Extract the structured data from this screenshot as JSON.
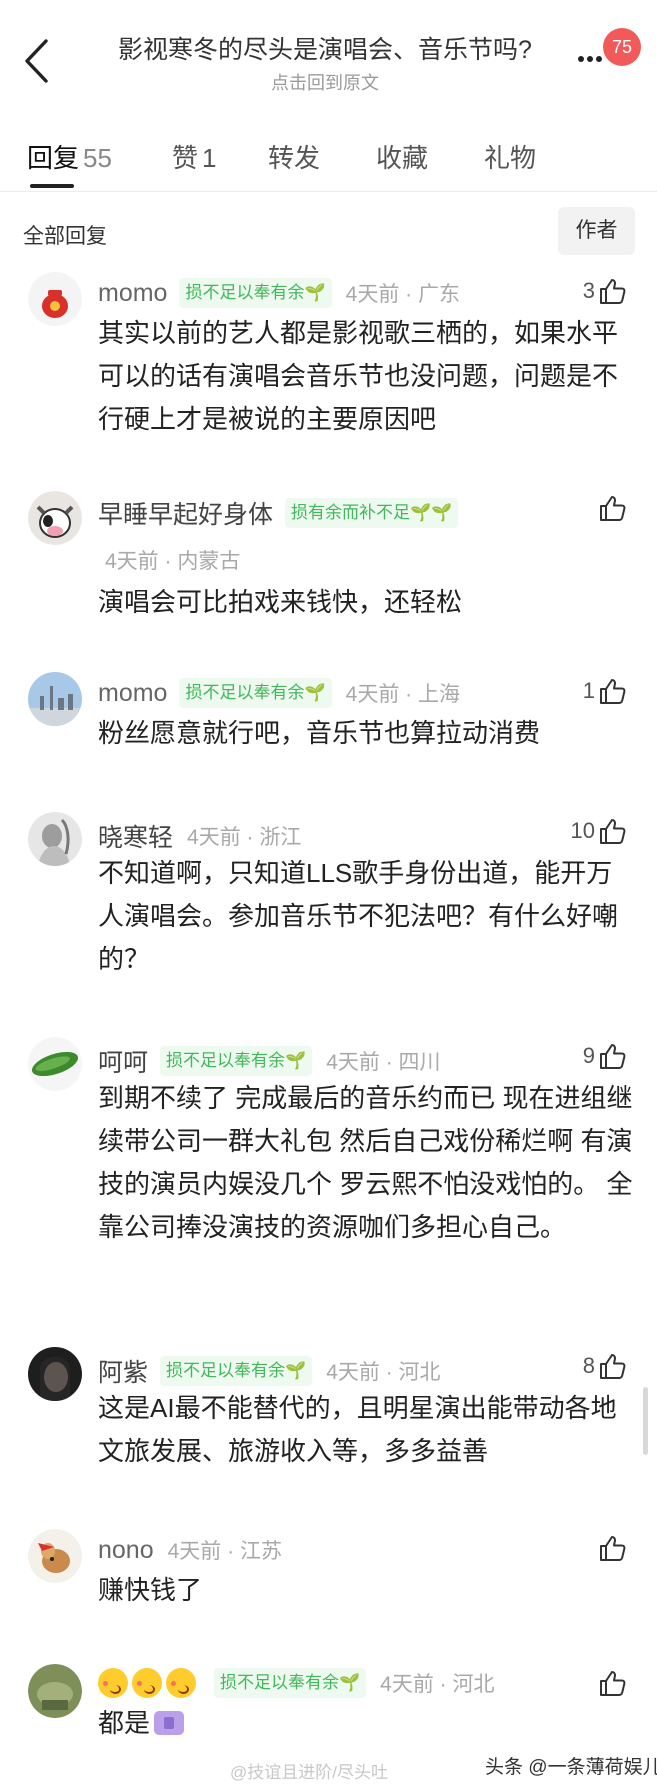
{
  "header": {
    "title": "影视寒冬的尽头是演唱会、音乐节吗?",
    "subtitle": "点击回到原文",
    "badge": "75"
  },
  "tabs": [
    {
      "label": "回复",
      "count": "55"
    },
    {
      "label": "赞",
      "count": "1"
    },
    {
      "label": "转发",
      "count": ""
    },
    {
      "label": "收藏",
      "count": ""
    },
    {
      "label": "礼物",
      "count": ""
    }
  ],
  "filter": {
    "label": "全部回复",
    "author_button": "作者"
  },
  "comments": [
    {
      "name": "momo",
      "tag": "损不足以奉有余🌱",
      "time": "4天前 · 广东",
      "likes": "3",
      "text": "其实以前的艺人都是影视歌三栖的，如果水平可以的话有演唱会音乐节也没问题，问题是不行硬上才是被说的主要原因吧"
    },
    {
      "name": "早睡早起好身体",
      "tag": "损有余而补不足🌱🌱",
      "time": "4天前 · 内蒙古",
      "likes": "",
      "text": "演唱会可比拍戏来钱快，还轻松"
    },
    {
      "name": "momo",
      "tag": "损不足以奉有余🌱",
      "time": "4天前 · 上海",
      "likes": "1",
      "text": "粉丝愿意就行吧，音乐节也算拉动消费"
    },
    {
      "name": "晓寒轻",
      "tag": "",
      "time": "4天前 · 浙江",
      "likes": "10",
      "text": "不知道啊，只知道LLS歌手身份出道，能开万人演唱会。参加音乐节不犯法吧？有什么好嘲的？"
    },
    {
      "name": "呵呵",
      "tag": "损不足以奉有余🌱",
      "time": "4天前 · 四川",
      "likes": "9",
      "text": "到期不续了 完成最后的音乐约而已  现在进组继续带公司一群大礼包 然后自己戏份稀烂啊  有演技的演员内娱没几个  罗云熙不怕没戏怕的。 全靠公司捧没演技的资源咖们多担心自己。"
    },
    {
      "name": "阿紫",
      "tag": "损不足以奉有余🌱",
      "time": "4天前 · 河北",
      "likes": "8",
      "text": "这是AI最不能替代的，且明星演出能带动各地文旅发展、旅游收入等，多多益善"
    },
    {
      "name": "nono",
      "tag": "",
      "time": "4天前 · 江苏",
      "likes": "",
      "text": "赚快钱了"
    },
    {
      "name": "",
      "tag": "损不足以奉有余🌱",
      "time": "4天前 · 河北",
      "likes": "",
      "text": "都是"
    }
  ],
  "watermark": {
    "left": "@技谊且进阶/尽头吐",
    "right": "头条 @一条薄荷娱儿"
  },
  "colors": {
    "badge": "#f25a5a",
    "tag_text": "#42b85a",
    "tag_bg": "#eefaf0"
  }
}
